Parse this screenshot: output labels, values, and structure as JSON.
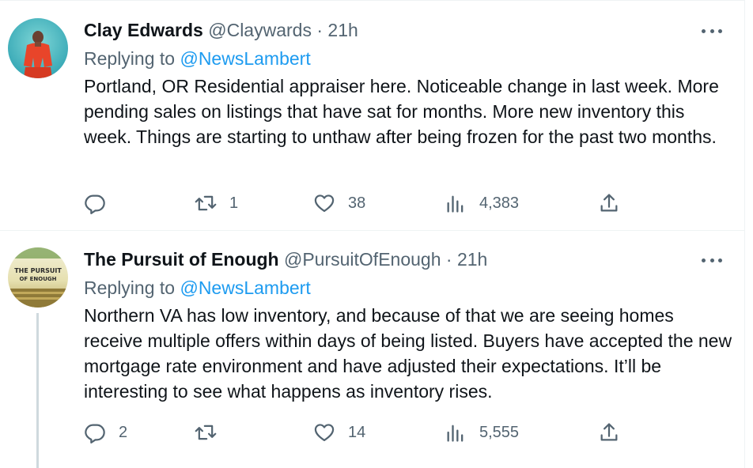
{
  "tweets": [
    {
      "display_name": "Clay Edwards",
      "handle": "@Claywards",
      "separator": "·",
      "time": "21h",
      "replying_prefix": "Replying to",
      "replying_to": "@NewsLambert",
      "text": "Portland, OR Residential appraiser here. Noticeable change in last week. More pending sales on listings that have sat for months. More new inventory this week. Things are starting to unthaw after being frozen for the past two months.",
      "replies": "",
      "retweets": "1",
      "likes": "38",
      "views": "4,383"
    },
    {
      "display_name": "The Pursuit of Enough",
      "handle": "@PursuitOfEnough",
      "separator": "·",
      "time": "21h",
      "replying_prefix": "Replying to",
      "replying_to": "@NewsLambert",
      "avatar_text_line1": "THE PURSUIT",
      "avatar_text_line2": "OF ENOUGH",
      "text": "Northern VA has low inventory, and because of that we are seeing homes receive multiple offers within days of being listed. Buyers have accepted the new mortgage rate environment and have adjusted their expectations. It’ll be interesting to see what happens as inventory rises.",
      "replies": "2",
      "retweets": "",
      "likes": "14",
      "views": "5,555"
    }
  ],
  "colors": {
    "text_primary": "#0f1419",
    "text_secondary": "#536471",
    "link": "#1d9bf0",
    "divider": "#eff3f4"
  },
  "icons": [
    "reply-icon",
    "retweet-icon",
    "like-icon",
    "views-icon",
    "share-icon",
    "more-icon"
  ]
}
